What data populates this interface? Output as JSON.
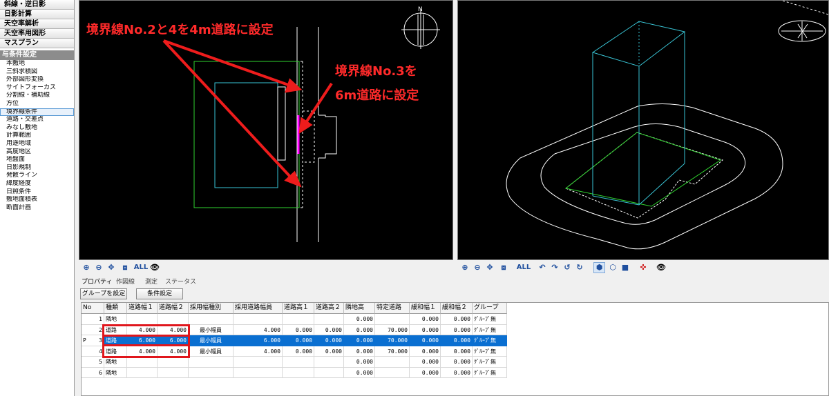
{
  "sidebar": {
    "categories": [
      "斜線・逆日影",
      "日影計算",
      "天空率解析",
      "天空率用図形",
      "マスプラン"
    ],
    "section_title": "与条件設定",
    "items": [
      "本敷地",
      "三斜求積図",
      "外部図形変換",
      "サイトフォーカス",
      "分割線・補助線",
      "方位",
      "境界線条件",
      "道路・交差点",
      "みなし敷地",
      "計算範囲",
      "用途地域",
      "高度地区",
      "地盤面",
      "日影規制",
      "発散ライン",
      "緯度経度",
      "日照条件",
      "敷地面積表",
      "断面計画"
    ],
    "selected_item": "境界線条件"
  },
  "annotations": {
    "road4m": "境界線No.2と4を4m道路に設定",
    "road6m_line1": "境界線No.3を",
    "road6m_line2": "6m道路に設定",
    "color": "#ff2a2a"
  },
  "left_toolbar": {
    "icons": [
      "zoom-in-icon",
      "zoom-out-icon",
      "pan-icon",
      "zoom-window-icon"
    ],
    "all_label": "ALL",
    "eye_icon": "eye-icon"
  },
  "right_toolbar": {
    "icons": [
      "zoom-in-icon",
      "zoom-out-icon",
      "pan-icon",
      "zoom-window-icon"
    ],
    "all_label": "ALL",
    "rotate_icons": [
      "rotate-left-icon",
      "rotate-right-icon",
      "rotate-up-icon",
      "rotate-down-icon"
    ],
    "view_icons": [
      "iso-view-icon",
      "wireframe-view-icon",
      "solid-view-icon",
      "axis-view-icon"
    ],
    "eye_icon": "eye-icon"
  },
  "panel": {
    "tabs": [
      "プロパティ",
      "作図線",
      "測定",
      "ステータス"
    ],
    "active_tab": "プロパティ",
    "buttons": {
      "group": "グループを設定",
      "condition": "条件設定"
    }
  },
  "grid": {
    "columns": [
      "No",
      "種類",
      "道路幅１",
      "道路幅２",
      "採用幅種別",
      "採用道路幅員",
      "道路高１",
      "道路高２",
      "隣地高",
      "特定道路",
      "緩和幅１",
      "緩和幅２",
      "グループ"
    ],
    "rows": [
      {
        "no": "1",
        "type": "隣地",
        "w1": "",
        "w2": "",
        "kind": "",
        "width": "",
        "h1": "",
        "h2": "",
        "neighbor": "0.000",
        "special": "",
        "r1": "0.000",
        "r2": "0.000",
        "group": "ｸﾞﾙｰﾌﾟ無"
      },
      {
        "no": "2",
        "type": "道路",
        "w1": "4.000",
        "w2": "4.000",
        "kind": "最小幅員",
        "width": "4.000",
        "h1": "0.000",
        "h2": "0.000",
        "neighbor": "0.000",
        "special": "70.000",
        "r1": "0.000",
        "r2": "0.000",
        "group": "ｸﾞﾙｰﾌﾟ無"
      },
      {
        "no": "3",
        "type": "道路",
        "w1": "6.000",
        "w2": "6.000",
        "kind": "最小幅員",
        "width": "6.000",
        "h1": "0.000",
        "h2": "0.000",
        "neighbor": "0.000",
        "special": "70.000",
        "r1": "0.000",
        "r2": "0.000",
        "group": "ｸﾞﾙｰﾌﾟ無"
      },
      {
        "no": "4",
        "type": "道路",
        "w1": "4.000",
        "w2": "4.000",
        "kind": "最小幅員",
        "width": "4.000",
        "h1": "0.000",
        "h2": "0.000",
        "neighbor": "0.000",
        "special": "70.000",
        "r1": "0.000",
        "r2": "0.000",
        "group": "ｸﾞﾙｰﾌﾟ無"
      },
      {
        "no": "5",
        "type": "隣地",
        "w1": "",
        "w2": "",
        "kind": "",
        "width": "",
        "h1": "",
        "h2": "",
        "neighbor": "0.000",
        "special": "",
        "r1": "0.000",
        "r2": "0.000",
        "group": "ｸﾞﾙｰﾌﾟ無"
      },
      {
        "no": "6",
        "type": "隣地",
        "w1": "",
        "w2": "",
        "kind": "",
        "width": "",
        "h1": "",
        "h2": "",
        "neighbor": "0.000",
        "special": "",
        "r1": "0.000",
        "r2": "0.000",
        "group": "ｸﾞﾙｰﾌﾟ無"
      }
    ],
    "selected_row": 2,
    "row_marker": "P",
    "selection_color": "#0a6fd1",
    "highlight_color": "#e0161c"
  },
  "colors": {
    "site_boundary": "#2fd42f",
    "building": "#39c5d6",
    "road_line": "#ffffff",
    "selected_boundary": "#ff00ff"
  }
}
